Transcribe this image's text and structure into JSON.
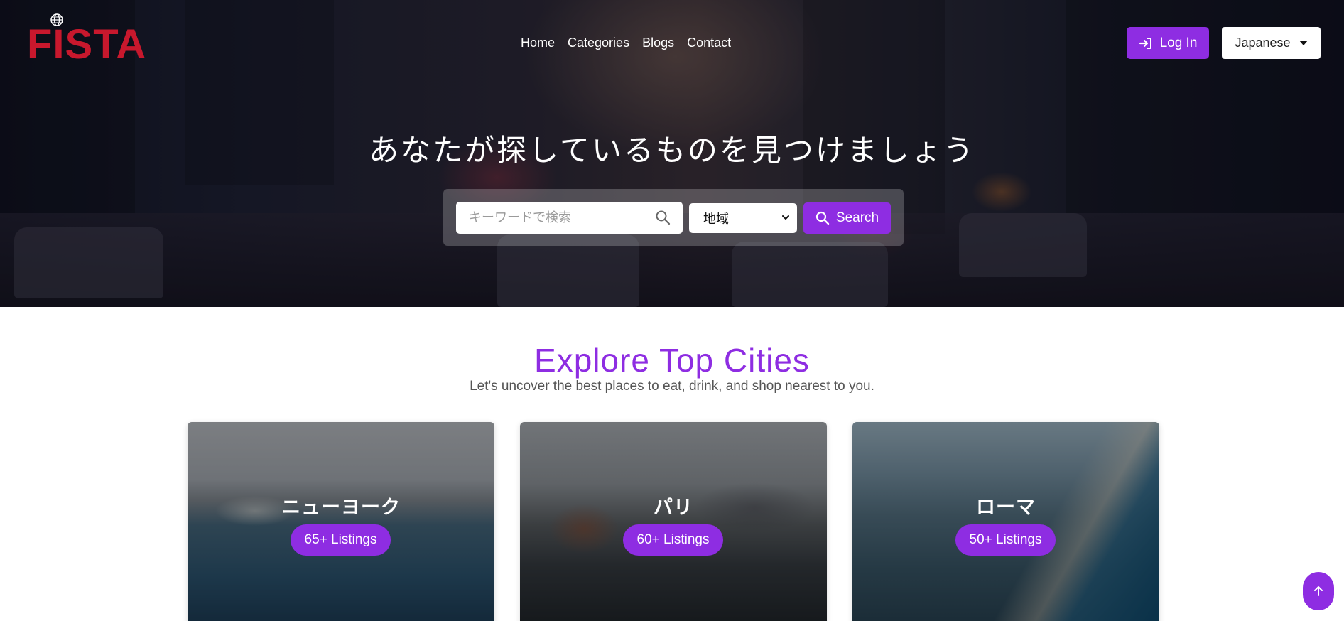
{
  "brand": {
    "logo_text": "FISTA",
    "accent": "#8e2de2",
    "logo_color": "#c8182d"
  },
  "nav": {
    "items": [
      {
        "label": "Home"
      },
      {
        "label": "Categories"
      },
      {
        "label": "Blogs"
      },
      {
        "label": "Contact"
      }
    ]
  },
  "header": {
    "login_label": "Log In",
    "language_label": "Japanese"
  },
  "hero": {
    "title": "あなたが探しているものを見つけましょう",
    "search": {
      "placeholder": "キーワードで検索",
      "value": "",
      "region_selected": "地域",
      "button_label": "Search"
    }
  },
  "section": {
    "title": "Explore Top Cities",
    "subtitle": "Let's uncover the best places to eat, drink, and shop nearest to you."
  },
  "cities": [
    {
      "name": "ニューヨーク",
      "listings": "65+ Listings"
    },
    {
      "name": "パリ",
      "listings": "60+ Listings"
    },
    {
      "name": "ローマ",
      "listings": "50+ Listings"
    }
  ],
  "icons": {
    "globe": "globe-icon",
    "login": "login-icon",
    "caret": "caret-down-icon",
    "search": "search-icon",
    "chevron": "chevron-down-icon",
    "up": "arrow-up-icon"
  }
}
